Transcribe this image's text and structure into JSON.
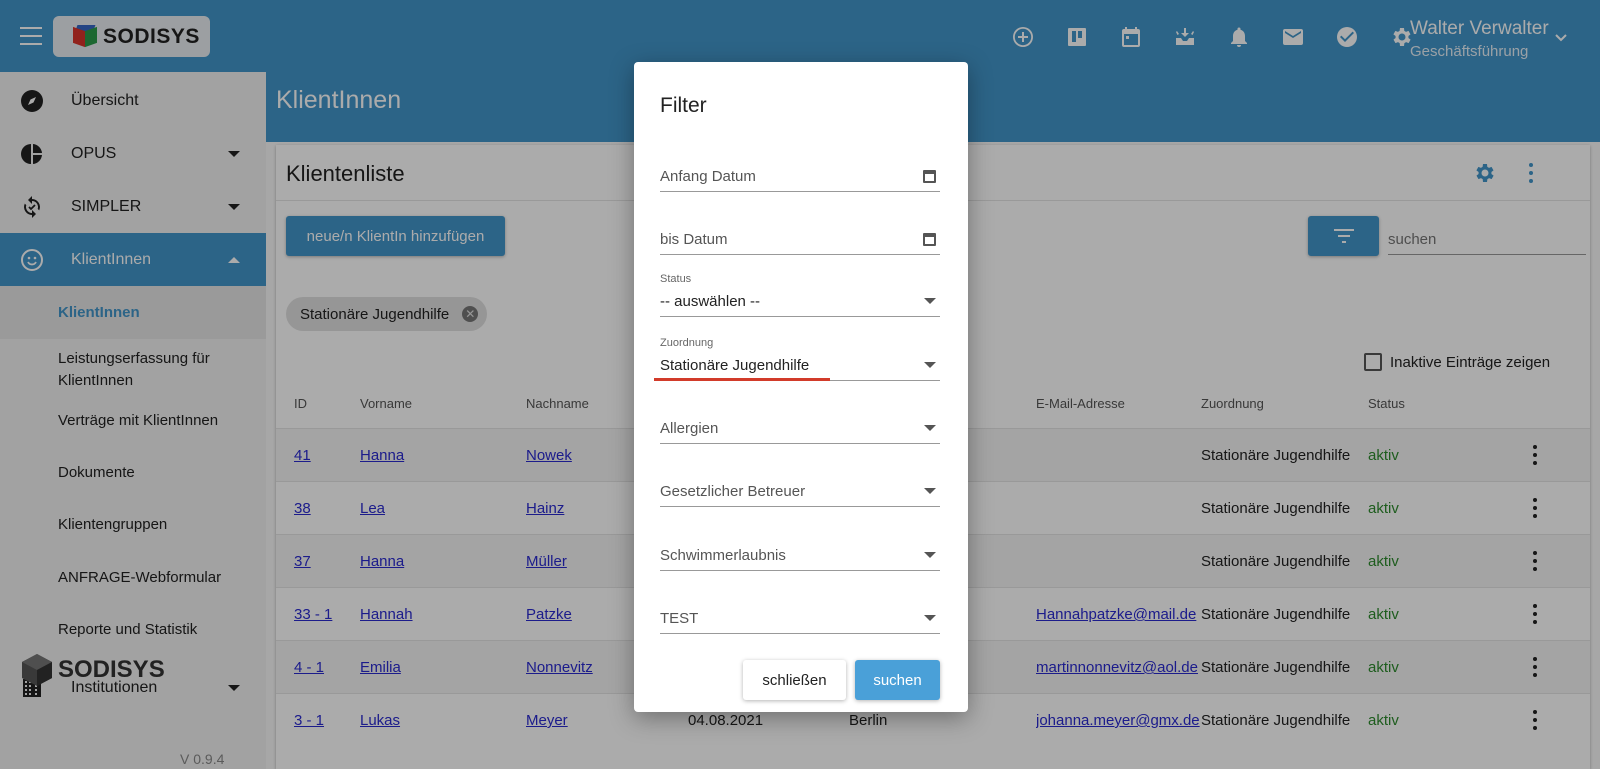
{
  "topbar": {
    "logo_text": "SODISYS",
    "icons": [
      "add-circle-icon",
      "board-icon",
      "calendar-icon",
      "inbox-icon",
      "bell-icon",
      "mail-icon",
      "check-circle-icon",
      "gear-icon"
    ],
    "user_name": "Walter Verwalter",
    "user_role": "Geschäftsführung"
  },
  "sidebar": {
    "items": [
      {
        "label": "Übersicht",
        "icon": "compass-icon"
      },
      {
        "label": "OPUS",
        "icon": "pie-chart-icon"
      },
      {
        "label": "SIMPLER",
        "icon": "sync-icon"
      },
      {
        "label": "KlientInnen",
        "icon": "smiley-icon"
      }
    ],
    "sub_items": [
      "KlientInnen",
      "Leistungserfassung für KlientInnen",
      "Verträge mit KlientInnen",
      "Dokumente",
      "Klientengruppen",
      "ANFRAGE-Webformular",
      "Reporte und Statistik"
    ],
    "institutionen": "Institutionen",
    "logo_text": "SODISYS",
    "version": "V 0.9.4"
  },
  "main": {
    "title": "KlientInnen",
    "card_title": "Klientenliste",
    "add_button": "neue/n KlientIn hinzufügen",
    "search_placeholder": "suchen",
    "chip": "Stationäre Jugendhilfe",
    "inactive_label": "Inaktive Einträge zeigen",
    "columns": [
      "ID",
      "Vorname",
      "Nachname",
      "E-Mail-Adresse",
      "Zuordnung",
      "Status"
    ],
    "rows": [
      {
        "id": "41",
        "vorname": "Hanna",
        "nachname": "Nowek",
        "datum": "",
        "ort": "",
        "email": "",
        "zuordnung": "Stationäre Jugendhilfe",
        "status": "aktiv"
      },
      {
        "id": "38",
        "vorname": "Lea",
        "nachname": "Hainz",
        "datum": "",
        "ort": "",
        "email": "",
        "zuordnung": "Stationäre Jugendhilfe",
        "status": "aktiv"
      },
      {
        "id": "37",
        "vorname": "Hanna",
        "nachname": "Müller",
        "datum": "",
        "ort": "",
        "email": "",
        "zuordnung": "Stationäre Jugendhilfe",
        "status": "aktiv"
      },
      {
        "id": "33 - 1",
        "vorname": "Hannah",
        "nachname": "Patzke",
        "datum": "",
        "ort": "",
        "email": "Hannahpatzke@mail.de",
        "zuordnung": "Stationäre Jugendhilfe",
        "status": "aktiv"
      },
      {
        "id": "4 - 1",
        "vorname": "Emilia",
        "nachname": "Nonnevitz",
        "datum": "",
        "ort": "",
        "email": "martinnonnevitz@aol.de",
        "zuordnung": "Stationäre Jugendhilfe",
        "status": "aktiv"
      },
      {
        "id": "3 - 1",
        "vorname": "Lukas",
        "nachname": "Meyer",
        "datum": "04.08.2021",
        "ort": "Berlin",
        "email": "johanna.meyer@gmx.de",
        "zuordnung": "Stationäre Jugendhilfe",
        "status": "aktiv"
      }
    ]
  },
  "modal": {
    "title": "Filter",
    "anfang_datum": "Anfang Datum",
    "bis_datum": "bis Datum",
    "status_label": "Status",
    "status_value": "-- auswählen --",
    "zuordnung_label": "Zuordnung",
    "zuordnung_value": "Stationäre Jugendhilfe",
    "allergien": "Allergien",
    "betreuer": "Gesetzlicher Betreuer",
    "schwimmer": "Schwimmerlaubnis",
    "test": "TEST",
    "close_button": "schließen",
    "search_button": "suchen"
  },
  "colors": {
    "primary": "#4295c9",
    "status_active": "#2e8b2e",
    "link": "#2a2ad0",
    "focus": "#d23b2a"
  }
}
